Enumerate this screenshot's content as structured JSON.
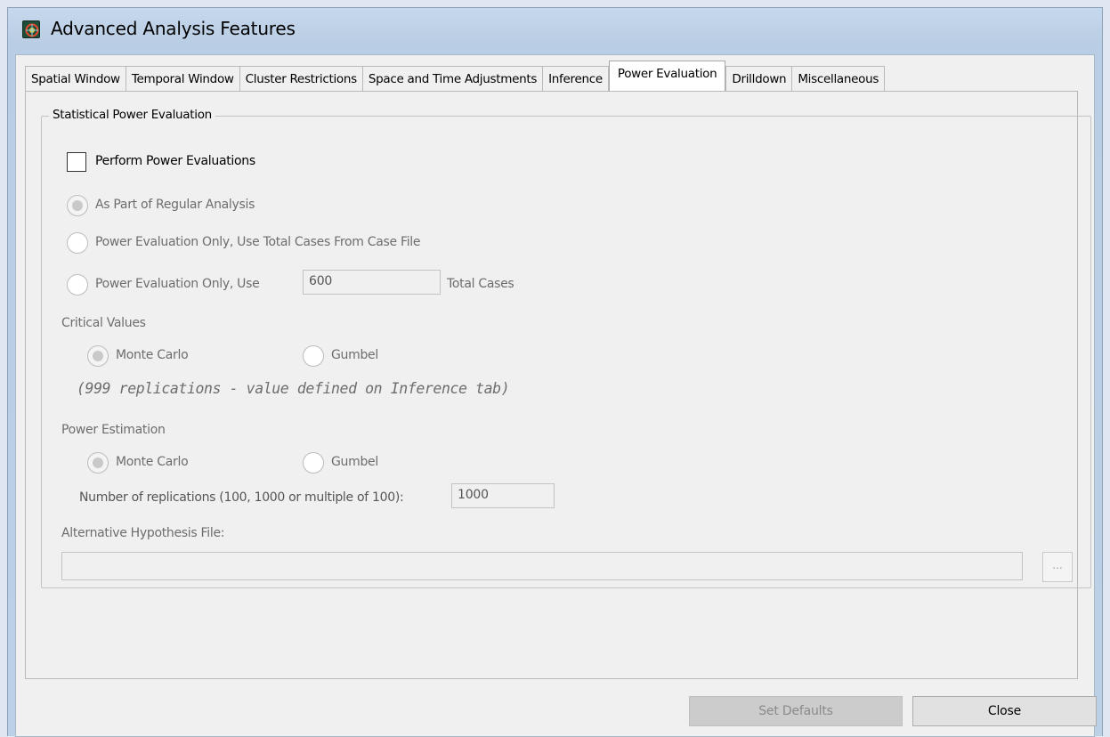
{
  "window": {
    "title": "Advanced Analysis Features"
  },
  "tabs": [
    {
      "label": "Spatial Window"
    },
    {
      "label": "Temporal Window"
    },
    {
      "label": "Cluster Restrictions"
    },
    {
      "label": "Space and Time Adjustments"
    },
    {
      "label": "Inference"
    },
    {
      "label": "Power Evaluation",
      "active": true
    },
    {
      "label": "Drilldown"
    },
    {
      "label": "Miscellaneous"
    }
  ],
  "power": {
    "group_title": "Statistical Power Evaluation",
    "perform_label": "Perform Power Evaluations",
    "perform_checked": false,
    "option_regular": "As Part of Regular Analysis",
    "option_case_file": "Power Evaluation Only, Use Total Cases From Case File",
    "option_use": "Power Evaluation Only, Use",
    "total_cases_value": "600",
    "total_cases_suffix": "Total Cases",
    "critical_values_title": "Critical Values",
    "critical_monte_carlo": "Monte Carlo",
    "critical_gumbel": "Gumbel",
    "replications_note": "(999 replications - value defined on Inference tab)",
    "estimation_title": "Power Estimation",
    "estimation_monte_carlo": "Monte Carlo",
    "estimation_gumbel": "Gumbel",
    "replications_label": "Number of replications (100, 1000 or multiple of 100):",
    "replications_value": "1000",
    "alt_file_label": "Alternative Hypothesis File:",
    "alt_file_value": "",
    "browse_label": "..."
  },
  "buttons": {
    "set_defaults": "Set Defaults",
    "close": "Close"
  }
}
